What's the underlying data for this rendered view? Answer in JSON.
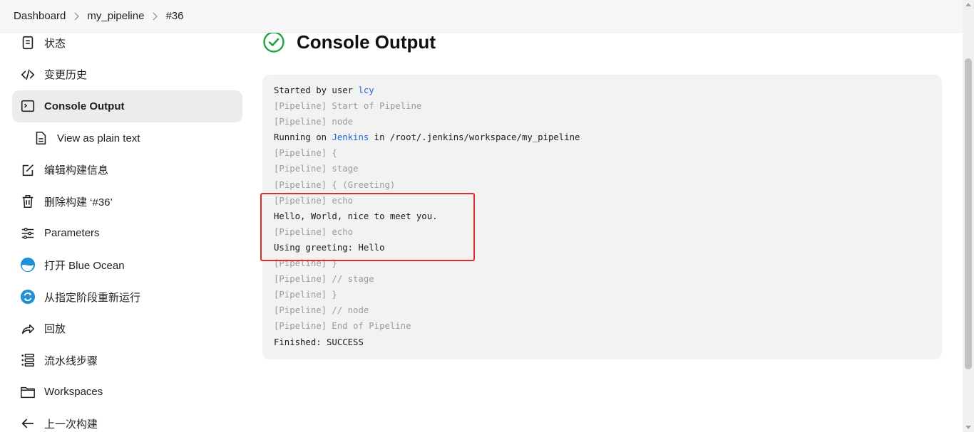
{
  "breadcrumb": {
    "items": [
      "Dashboard",
      "my_pipeline",
      "#36"
    ]
  },
  "sidebar": {
    "items": [
      {
        "label": "状态",
        "icon": "document-icon"
      },
      {
        "label": "变更历史",
        "icon": "code-icon"
      },
      {
        "label": "Console Output",
        "icon": "terminal-icon",
        "active": true
      },
      {
        "label": "View as plain text",
        "icon": "file-icon",
        "sub": true
      },
      {
        "label": "编辑构建信息",
        "icon": "edit-icon"
      },
      {
        "label": "删除构建 ‘#36’",
        "icon": "trash-icon"
      },
      {
        "label": "Parameters",
        "icon": "sliders-icon"
      },
      {
        "label": "打开 Blue Ocean",
        "icon": "blue-ocean-icon"
      },
      {
        "label": "从指定阶段重新运行",
        "icon": "rerun-icon"
      },
      {
        "label": "回放",
        "icon": "replay-icon"
      },
      {
        "label": "流水线步骤",
        "icon": "steps-icon"
      },
      {
        "label": "Workspaces",
        "icon": "folder-icon"
      },
      {
        "label": "上一次构建",
        "icon": "arrow-left-icon"
      }
    ]
  },
  "main": {
    "title": "Console Output",
    "status_icon": "success-check-icon",
    "status_color": "#1ea446"
  },
  "console": {
    "line0_prefix": "Started by user ",
    "line0_link": "lcy",
    "line1": "[Pipeline] Start of Pipeline",
    "line2": "[Pipeline] node",
    "line3_prefix": "Running on ",
    "line3_link": "Jenkins",
    "line3_suffix": " in /root/.jenkins/workspace/my_pipeline",
    "line4": "[Pipeline] {",
    "line5": "[Pipeline] stage",
    "line6": "[Pipeline] { (Greeting)",
    "line7": "[Pipeline] echo",
    "line8": "Hello, World, nice to meet you.",
    "line9": "[Pipeline] echo",
    "line10": "Using greeting: Hello",
    "line11": "[Pipeline] }",
    "line12": "[Pipeline] // stage",
    "line13": "[Pipeline] }",
    "line14": "[Pipeline] // node",
    "line15": "[Pipeline] End of Pipeline",
    "line16": "Finished: SUCCESS"
  },
  "colors": {
    "link": "#1a6ad3",
    "highlight_border": "#e02b2b",
    "console_bg": "#f2f2f2"
  }
}
